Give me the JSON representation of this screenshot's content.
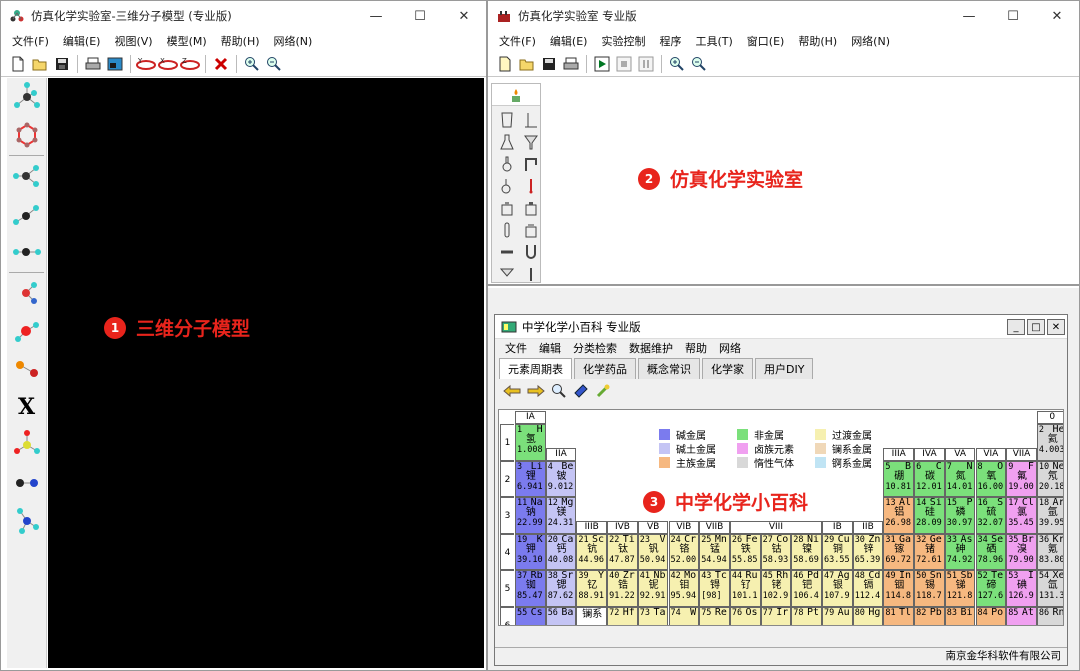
{
  "win1": {
    "title": "仿真化学实验室-三维分子模型  (专业版)",
    "menu": [
      "文件(F)",
      "编辑(E)",
      "视图(V)",
      "模型(M)",
      "帮助(H)",
      "网络(N)"
    ],
    "controls": {
      "min": "—",
      "max": "☐",
      "close": "✕"
    },
    "sidebar_x": "X"
  },
  "win2": {
    "title": "仿真化学实验室  专业版",
    "menu": [
      "文件(F)",
      "编辑(E)",
      "实验控制",
      "程序",
      "工具(T)",
      "窗口(E)",
      "帮助(H)",
      "网络(N)"
    ],
    "controls": {
      "min": "—",
      "max": "☐",
      "close": "✕"
    }
  },
  "encyclopedia": {
    "title": "中学化学小百科  专业版",
    "menu": [
      "文件",
      "编辑",
      "分类检索",
      "数据维护",
      "帮助",
      "网络"
    ],
    "tabs": [
      "元素周期表",
      "化学药品",
      "概念常识",
      "化学家",
      "用户DIY"
    ],
    "status": "南京金华科软件有限公司",
    "controls": {
      "min": "_",
      "max": "□",
      "close": "✕"
    }
  },
  "annotations": [
    {
      "num": "1",
      "label": "三维分子模型"
    },
    {
      "num": "2",
      "label": "仿真化学实验室"
    },
    {
      "num": "3",
      "label": "中学化学小百科"
    }
  ],
  "legend": [
    {
      "label": "碱金属",
      "color": "#7b7bee"
    },
    {
      "label": "非金属",
      "color": "#7be07b"
    },
    {
      "label": "过渡金属",
      "color": "#f6f0b0"
    },
    {
      "label": "碱土金属",
      "color": "#c4c4f4"
    },
    {
      "label": "卤族元素",
      "color": "#f0a0f0"
    },
    {
      "label": "镧系金属",
      "color": "#f0d8b8"
    },
    {
      "label": "主族金属",
      "color": "#f6b880"
    },
    {
      "label": "惰性气体",
      "color": "#d8d8d8"
    },
    {
      "label": "锕系金属",
      "color": "#c0e4f4"
    }
  ],
  "table": {
    "group_headers": [
      "IA",
      "IIA",
      "IIIB",
      "IVB",
      "VB",
      "VIB",
      "VIIB",
      "VIII",
      "IB",
      "IIB",
      "IIIA",
      "IVA",
      "VA",
      "VIA",
      "VIIA",
      "0"
    ],
    "periods": [
      "1",
      "2",
      "3",
      "4",
      "5",
      "6"
    ],
    "lanthanide_label": "镧系",
    "elements": [
      {
        "n": "1",
        "s": "H",
        "c": "氢",
        "m": "1.008",
        "r": 1,
        "g": 1,
        "t": "nm"
      },
      {
        "n": "2",
        "s": "He",
        "c": "氦",
        "m": "4.003",
        "r": 1,
        "g": 18,
        "t": "ng"
      },
      {
        "n": "3",
        "s": "Li",
        "c": "锂",
        "m": "6.941",
        "r": 2,
        "g": 1,
        "t": "am"
      },
      {
        "n": "4",
        "s": "Be",
        "c": "铍",
        "m": "9.012",
        "r": 2,
        "g": 2,
        "t": "ae"
      },
      {
        "n": "5",
        "s": "B",
        "c": "硼",
        "m": "10.81",
        "r": 2,
        "g": 13,
        "t": "nm"
      },
      {
        "n": "6",
        "s": "C",
        "c": "碳",
        "m": "12.01",
        "r": 2,
        "g": 14,
        "t": "nm"
      },
      {
        "n": "7",
        "s": "N",
        "c": "氮",
        "m": "14.01",
        "r": 2,
        "g": 15,
        "t": "nm"
      },
      {
        "n": "8",
        "s": "O",
        "c": "氧",
        "m": "16.00",
        "r": 2,
        "g": 16,
        "t": "nm"
      },
      {
        "n": "9",
        "s": "F",
        "c": "氟",
        "m": "19.00",
        "r": 2,
        "g": 17,
        "t": "hal"
      },
      {
        "n": "10",
        "s": "Ne",
        "c": "氖",
        "m": "20.18",
        "r": 2,
        "g": 18,
        "t": "ng"
      },
      {
        "n": "11",
        "s": "Na",
        "c": "钠",
        "m": "22.99",
        "r": 3,
        "g": 1,
        "t": "am"
      },
      {
        "n": "12",
        "s": "Mg",
        "c": "镁",
        "m": "24.31",
        "r": 3,
        "g": 2,
        "t": "ae"
      },
      {
        "n": "13",
        "s": "Al",
        "c": "铝",
        "m": "26.98",
        "r": 3,
        "g": 13,
        "t": "pm"
      },
      {
        "n": "14",
        "s": "Si",
        "c": "硅",
        "m": "28.09",
        "r": 3,
        "g": 14,
        "t": "nm"
      },
      {
        "n": "15",
        "s": "P",
        "c": "磷",
        "m": "30.97",
        "r": 3,
        "g": 15,
        "t": "nm"
      },
      {
        "n": "16",
        "s": "S",
        "c": "硫",
        "m": "32.07",
        "r": 3,
        "g": 16,
        "t": "nm"
      },
      {
        "n": "17",
        "s": "Cl",
        "c": "氯",
        "m": "35.45",
        "r": 3,
        "g": 17,
        "t": "hal"
      },
      {
        "n": "18",
        "s": "Ar",
        "c": "氩",
        "m": "39.95",
        "r": 3,
        "g": 18,
        "t": "ng"
      },
      {
        "n": "19",
        "s": "K",
        "c": "钾",
        "m": "39.10",
        "r": 4,
        "g": 1,
        "t": "am"
      },
      {
        "n": "20",
        "s": "Ca",
        "c": "钙",
        "m": "40.08",
        "r": 4,
        "g": 2,
        "t": "ae"
      },
      {
        "n": "21",
        "s": "Sc",
        "c": "钪",
        "m": "44.96",
        "r": 4,
        "g": 3,
        "t": "tm"
      },
      {
        "n": "22",
        "s": "Ti",
        "c": "钛",
        "m": "47.87",
        "r": 4,
        "g": 4,
        "t": "tm"
      },
      {
        "n": "23",
        "s": "V",
        "c": "钒",
        "m": "50.94",
        "r": 4,
        "g": 5,
        "t": "tm"
      },
      {
        "n": "24",
        "s": "Cr",
        "c": "铬",
        "m": "52.00",
        "r": 4,
        "g": 6,
        "t": "tm"
      },
      {
        "n": "25",
        "s": "Mn",
        "c": "锰",
        "m": "54.94",
        "r": 4,
        "g": 7,
        "t": "tm"
      },
      {
        "n": "26",
        "s": "Fe",
        "c": "铁",
        "m": "55.85",
        "r": 4,
        "g": 8,
        "t": "tm"
      },
      {
        "n": "27",
        "s": "Co",
        "c": "钴",
        "m": "58.93",
        "r": 4,
        "g": 9,
        "t": "tm"
      },
      {
        "n": "28",
        "s": "Ni",
        "c": "镍",
        "m": "58.69",
        "r": 4,
        "g": 10,
        "t": "tm"
      },
      {
        "n": "29",
        "s": "Cu",
        "c": "铜",
        "m": "63.55",
        "r": 4,
        "g": 11,
        "t": "tm"
      },
      {
        "n": "30",
        "s": "Zn",
        "c": "锌",
        "m": "65.39",
        "r": 4,
        "g": 12,
        "t": "tm"
      },
      {
        "n": "31",
        "s": "Ga",
        "c": "镓",
        "m": "69.72",
        "r": 4,
        "g": 13,
        "t": "pm"
      },
      {
        "n": "32",
        "s": "Ge",
        "c": "锗",
        "m": "72.61",
        "r": 4,
        "g": 14,
        "t": "pm"
      },
      {
        "n": "33",
        "s": "As",
        "c": "砷",
        "m": "74.92",
        "r": 4,
        "g": 15,
        "t": "nm"
      },
      {
        "n": "34",
        "s": "Se",
        "c": "硒",
        "m": "78.96",
        "r": 4,
        "g": 16,
        "t": "nm"
      },
      {
        "n": "35",
        "s": "Br",
        "c": "溴",
        "m": "79.90",
        "r": 4,
        "g": 17,
        "t": "hal"
      },
      {
        "n": "36",
        "s": "Kr",
        "c": "氪",
        "m": "83.80",
        "r": 4,
        "g": 18,
        "t": "ng"
      },
      {
        "n": "37",
        "s": "Rb",
        "c": "铷",
        "m": "85.47",
        "r": 5,
        "g": 1,
        "t": "am"
      },
      {
        "n": "38",
        "s": "Sr",
        "c": "锶",
        "m": "87.62",
        "r": 5,
        "g": 2,
        "t": "ae"
      },
      {
        "n": "39",
        "s": "Y",
        "c": "钇",
        "m": "88.91",
        "r": 5,
        "g": 3,
        "t": "tm"
      },
      {
        "n": "40",
        "s": "Zr",
        "c": "锆",
        "m": "91.22",
        "r": 5,
        "g": 4,
        "t": "tm"
      },
      {
        "n": "41",
        "s": "Nb",
        "c": "铌",
        "m": "92.91",
        "r": 5,
        "g": 5,
        "t": "tm"
      },
      {
        "n": "42",
        "s": "Mo",
        "c": "钼",
        "m": "95.94",
        "r": 5,
        "g": 6,
        "t": "tm"
      },
      {
        "n": "43",
        "s": "Tc",
        "c": "锝",
        "m": "[98]",
        "r": 5,
        "g": 7,
        "t": "tm"
      },
      {
        "n": "44",
        "s": "Ru",
        "c": "钌",
        "m": "101.1",
        "r": 5,
        "g": 8,
        "t": "tm"
      },
      {
        "n": "45",
        "s": "Rh",
        "c": "铑",
        "m": "102.9",
        "r": 5,
        "g": 9,
        "t": "tm"
      },
      {
        "n": "46",
        "s": "Pd",
        "c": "钯",
        "m": "106.4",
        "r": 5,
        "g": 10,
        "t": "tm"
      },
      {
        "n": "47",
        "s": "Ag",
        "c": "银",
        "m": "107.9",
        "r": 5,
        "g": 11,
        "t": "tm"
      },
      {
        "n": "48",
        "s": "Cd",
        "c": "镉",
        "m": "112.4",
        "r": 5,
        "g": 12,
        "t": "tm"
      },
      {
        "n": "49",
        "s": "In",
        "c": "铟",
        "m": "114.8",
        "r": 5,
        "g": 13,
        "t": "pm"
      },
      {
        "n": "50",
        "s": "Sn",
        "c": "锡",
        "m": "118.7",
        "r": 5,
        "g": 14,
        "t": "pm"
      },
      {
        "n": "51",
        "s": "Sb",
        "c": "锑",
        "m": "121.8",
        "r": 5,
        "g": 15,
        "t": "pm"
      },
      {
        "n": "52",
        "s": "Te",
        "c": "碲",
        "m": "127.6",
        "r": 5,
        "g": 16,
        "t": "nm"
      },
      {
        "n": "53",
        "s": "I",
        "c": "碘",
        "m": "126.9",
        "r": 5,
        "g": 17,
        "t": "hal"
      },
      {
        "n": "54",
        "s": "Xe",
        "c": "氙",
        "m": "131.3",
        "r": 5,
        "g": 18,
        "t": "ng"
      },
      {
        "n": "55",
        "s": "Cs",
        "c": "",
        "m": "",
        "r": 6,
        "g": 1,
        "t": "am"
      },
      {
        "n": "56",
        "s": "Ba",
        "c": "",
        "m": "",
        "r": 6,
        "g": 2,
        "t": "ae"
      },
      {
        "n": "72",
        "s": "Hf",
        "c": "",
        "m": "",
        "r": 6,
        "g": 4,
        "t": "tm"
      },
      {
        "n": "73",
        "s": "Ta",
        "c": "",
        "m": "",
        "r": 6,
        "g": 5,
        "t": "tm"
      },
      {
        "n": "74",
        "s": "W",
        "c": "",
        "m": "",
        "r": 6,
        "g": 6,
        "t": "tm"
      },
      {
        "n": "75",
        "s": "Re",
        "c": "",
        "m": "",
        "r": 6,
        "g": 7,
        "t": "tm"
      },
      {
        "n": "76",
        "s": "Os",
        "c": "",
        "m": "",
        "r": 6,
        "g": 8,
        "t": "tm"
      },
      {
        "n": "77",
        "s": "Ir",
        "c": "",
        "m": "",
        "r": 6,
        "g": 9,
        "t": "tm"
      },
      {
        "n": "78",
        "s": "Pt",
        "c": "",
        "m": "",
        "r": 6,
        "g": 10,
        "t": "tm"
      },
      {
        "n": "79",
        "s": "Au",
        "c": "",
        "m": "",
        "r": 6,
        "g": 11,
        "t": "tm"
      },
      {
        "n": "80",
        "s": "Hg",
        "c": "",
        "m": "",
        "r": 6,
        "g": 12,
        "t": "tm"
      },
      {
        "n": "81",
        "s": "Tl",
        "c": "",
        "m": "",
        "r": 6,
        "g": 13,
        "t": "pm"
      },
      {
        "n": "82",
        "s": "Pb",
        "c": "",
        "m": "",
        "r": 6,
        "g": 14,
        "t": "pm"
      },
      {
        "n": "83",
        "s": "Bi",
        "c": "",
        "m": "",
        "r": 6,
        "g": 15,
        "t": "pm"
      },
      {
        "n": "84",
        "s": "Po",
        "c": "",
        "m": "",
        "r": 6,
        "g": 16,
        "t": "pm"
      },
      {
        "n": "85",
        "s": "At",
        "c": "",
        "m": "",
        "r": 6,
        "g": 17,
        "t": "hal"
      },
      {
        "n": "86",
        "s": "Rn",
        "c": "",
        "m": "",
        "r": 6,
        "g": 18,
        "t": "ng"
      }
    ]
  },
  "colors": {
    "am": "#7b7bee",
    "ae": "#c4c4f4",
    "tm": "#f6f0b0",
    "nm": "#7be07b",
    "hal": "#f0a0f0",
    "ng": "#d8d8d8",
    "pm": "#f6b880",
    "la": "#f0d8b8",
    "ac": "#c0e4f4",
    "accent": "#e8241c"
  }
}
